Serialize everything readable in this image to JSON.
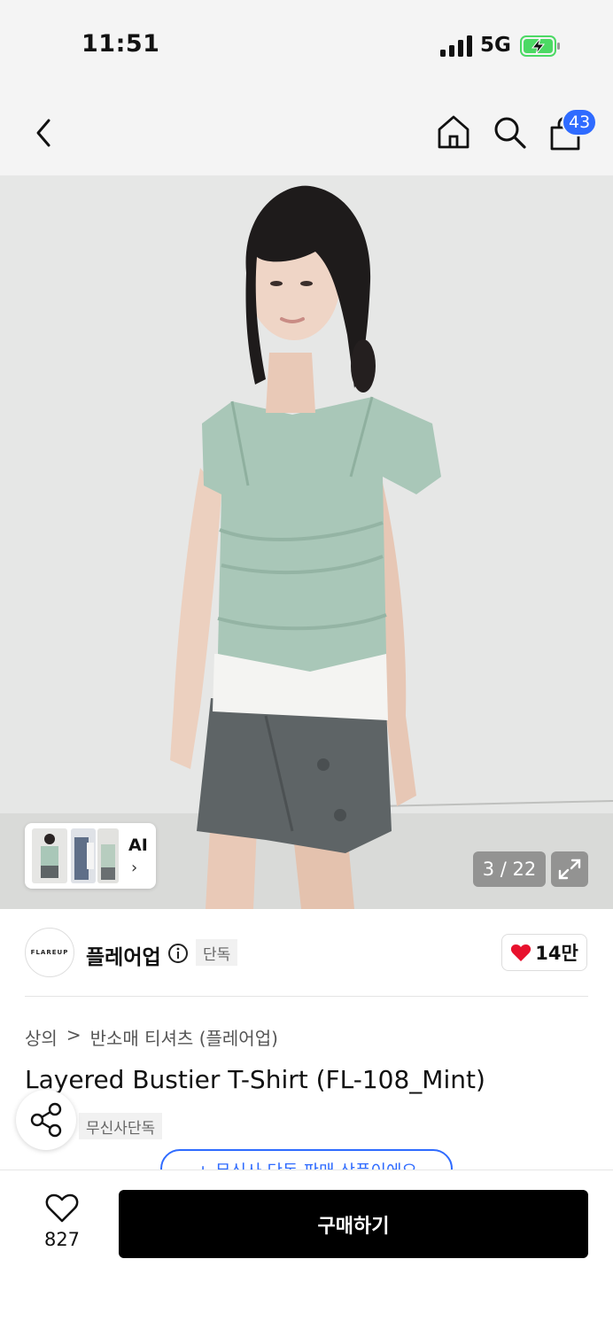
{
  "status_bar": {
    "time": "11:51",
    "network": "5G"
  },
  "nav": {
    "cart_badge": "43"
  },
  "gallery": {
    "counter": "3 / 22",
    "ai_label": "AI",
    "ai_arrow": "›"
  },
  "brand": {
    "logo_text": "FLAREUP",
    "name": "플레어업",
    "exclusive_tag": "단독",
    "like_count": "14만"
  },
  "breadcrumb": {
    "category": "상의",
    "separator": ">",
    "subcategory": "반소매 티셔츠 (플레어업)"
  },
  "product": {
    "title": "Layered Bustier T-Shirt (FL-108_Mint)",
    "musinsa_tag": "무신사단독",
    "promo_text": "+ 무신사 단독 판매 상품이에요"
  },
  "bottom_bar": {
    "wish_count": "827",
    "buy_label": "구매하기"
  },
  "colors": {
    "accent": "#2f6bff",
    "heart": "#e8112d",
    "buy_button": "#000000"
  },
  "icons": [
    "back-icon",
    "home-icon",
    "search-icon",
    "cart-icon",
    "info-icon",
    "heart-icon",
    "share-icon",
    "expand-icon"
  ]
}
